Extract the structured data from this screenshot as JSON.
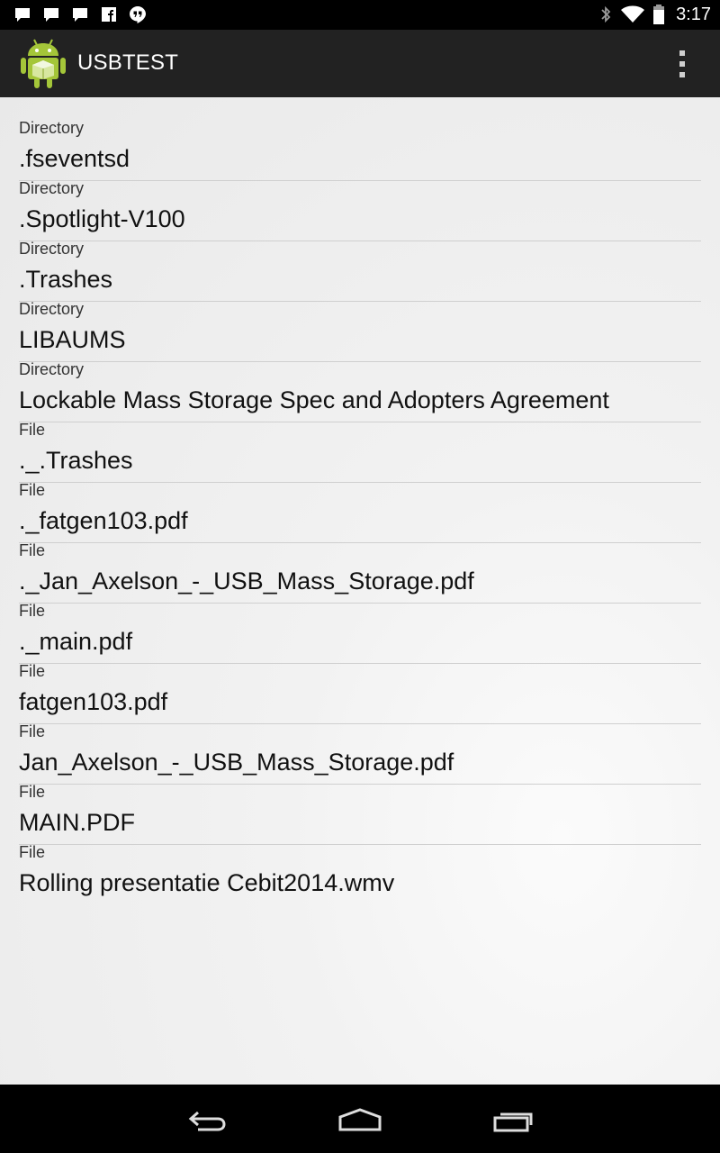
{
  "status_bar": {
    "time": "3:17",
    "notification_icons": [
      "message-icon",
      "message-icon",
      "message-icon",
      "facebook-icon",
      "hangouts-icon"
    ],
    "system_icons": [
      "bluetooth-icon",
      "wifi-icon",
      "battery-icon"
    ]
  },
  "action_bar": {
    "title": "USBTEST",
    "app_icon": "android-robot-icon",
    "overflow_icon": "overflow-menu-icon"
  },
  "file_list": {
    "items": [
      {
        "type": "Directory",
        "name": ".fseventsd"
      },
      {
        "type": "Directory",
        "name": ".Spotlight-V100"
      },
      {
        "type": "Directory",
        "name": ".Trashes"
      },
      {
        "type": "Directory",
        "name": "LIBAUMS"
      },
      {
        "type": "Directory",
        "name": "Lockable Mass Storage Spec and Adopters Agreement"
      },
      {
        "type": "File",
        "name": "._.Trashes"
      },
      {
        "type": "File",
        "name": "._fatgen103.pdf"
      },
      {
        "type": "File",
        "name": "._Jan_Axelson_-_USB_Mass_Storage.pdf"
      },
      {
        "type": "File",
        "name": "._main.pdf"
      },
      {
        "type": "File",
        "name": "fatgen103.pdf"
      },
      {
        "type": "File",
        "name": "Jan_Axelson_-_USB_Mass_Storage.pdf"
      },
      {
        "type": "File",
        "name": "MAIN.PDF"
      },
      {
        "type": "File",
        "name": "Rolling presentatie Cebit2014.wmv"
      }
    ]
  },
  "nav_bar": {
    "buttons": [
      "back-icon",
      "home-icon",
      "recents-icon"
    ]
  },
  "colors": {
    "action_bar": "#222222",
    "android_green": "#a4c639",
    "content_bg": "#f2f2f2"
  }
}
